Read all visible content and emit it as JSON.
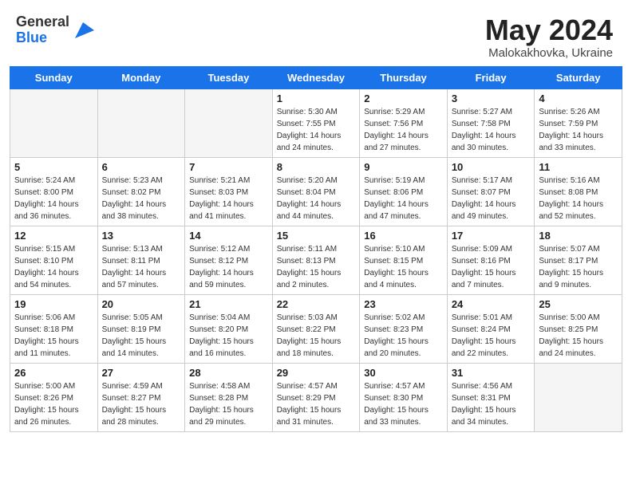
{
  "header": {
    "logo_general": "General",
    "logo_blue": "Blue",
    "month_year": "May 2024",
    "location": "Malokakhovka, Ukraine"
  },
  "weekdays": [
    "Sunday",
    "Monday",
    "Tuesday",
    "Wednesday",
    "Thursday",
    "Friday",
    "Saturday"
  ],
  "weeks": [
    [
      {
        "day": "",
        "info": ""
      },
      {
        "day": "",
        "info": ""
      },
      {
        "day": "",
        "info": ""
      },
      {
        "day": "1",
        "info": "Sunrise: 5:30 AM\nSunset: 7:55 PM\nDaylight: 14 hours\nand 24 minutes."
      },
      {
        "day": "2",
        "info": "Sunrise: 5:29 AM\nSunset: 7:56 PM\nDaylight: 14 hours\nand 27 minutes."
      },
      {
        "day": "3",
        "info": "Sunrise: 5:27 AM\nSunset: 7:58 PM\nDaylight: 14 hours\nand 30 minutes."
      },
      {
        "day": "4",
        "info": "Sunrise: 5:26 AM\nSunset: 7:59 PM\nDaylight: 14 hours\nand 33 minutes."
      }
    ],
    [
      {
        "day": "5",
        "info": "Sunrise: 5:24 AM\nSunset: 8:00 PM\nDaylight: 14 hours\nand 36 minutes."
      },
      {
        "day": "6",
        "info": "Sunrise: 5:23 AM\nSunset: 8:02 PM\nDaylight: 14 hours\nand 38 minutes."
      },
      {
        "day": "7",
        "info": "Sunrise: 5:21 AM\nSunset: 8:03 PM\nDaylight: 14 hours\nand 41 minutes."
      },
      {
        "day": "8",
        "info": "Sunrise: 5:20 AM\nSunset: 8:04 PM\nDaylight: 14 hours\nand 44 minutes."
      },
      {
        "day": "9",
        "info": "Sunrise: 5:19 AM\nSunset: 8:06 PM\nDaylight: 14 hours\nand 47 minutes."
      },
      {
        "day": "10",
        "info": "Sunrise: 5:17 AM\nSunset: 8:07 PM\nDaylight: 14 hours\nand 49 minutes."
      },
      {
        "day": "11",
        "info": "Sunrise: 5:16 AM\nSunset: 8:08 PM\nDaylight: 14 hours\nand 52 minutes."
      }
    ],
    [
      {
        "day": "12",
        "info": "Sunrise: 5:15 AM\nSunset: 8:10 PM\nDaylight: 14 hours\nand 54 minutes."
      },
      {
        "day": "13",
        "info": "Sunrise: 5:13 AM\nSunset: 8:11 PM\nDaylight: 14 hours\nand 57 minutes."
      },
      {
        "day": "14",
        "info": "Sunrise: 5:12 AM\nSunset: 8:12 PM\nDaylight: 14 hours\nand 59 minutes."
      },
      {
        "day": "15",
        "info": "Sunrise: 5:11 AM\nSunset: 8:13 PM\nDaylight: 15 hours\nand 2 minutes."
      },
      {
        "day": "16",
        "info": "Sunrise: 5:10 AM\nSunset: 8:15 PM\nDaylight: 15 hours\nand 4 minutes."
      },
      {
        "day": "17",
        "info": "Sunrise: 5:09 AM\nSunset: 8:16 PM\nDaylight: 15 hours\nand 7 minutes."
      },
      {
        "day": "18",
        "info": "Sunrise: 5:07 AM\nSunset: 8:17 PM\nDaylight: 15 hours\nand 9 minutes."
      }
    ],
    [
      {
        "day": "19",
        "info": "Sunrise: 5:06 AM\nSunset: 8:18 PM\nDaylight: 15 hours\nand 11 minutes."
      },
      {
        "day": "20",
        "info": "Sunrise: 5:05 AM\nSunset: 8:19 PM\nDaylight: 15 hours\nand 14 minutes."
      },
      {
        "day": "21",
        "info": "Sunrise: 5:04 AM\nSunset: 8:20 PM\nDaylight: 15 hours\nand 16 minutes."
      },
      {
        "day": "22",
        "info": "Sunrise: 5:03 AM\nSunset: 8:22 PM\nDaylight: 15 hours\nand 18 minutes."
      },
      {
        "day": "23",
        "info": "Sunrise: 5:02 AM\nSunset: 8:23 PM\nDaylight: 15 hours\nand 20 minutes."
      },
      {
        "day": "24",
        "info": "Sunrise: 5:01 AM\nSunset: 8:24 PM\nDaylight: 15 hours\nand 22 minutes."
      },
      {
        "day": "25",
        "info": "Sunrise: 5:00 AM\nSunset: 8:25 PM\nDaylight: 15 hours\nand 24 minutes."
      }
    ],
    [
      {
        "day": "26",
        "info": "Sunrise: 5:00 AM\nSunset: 8:26 PM\nDaylight: 15 hours\nand 26 minutes."
      },
      {
        "day": "27",
        "info": "Sunrise: 4:59 AM\nSunset: 8:27 PM\nDaylight: 15 hours\nand 28 minutes."
      },
      {
        "day": "28",
        "info": "Sunrise: 4:58 AM\nSunset: 8:28 PM\nDaylight: 15 hours\nand 29 minutes."
      },
      {
        "day": "29",
        "info": "Sunrise: 4:57 AM\nSunset: 8:29 PM\nDaylight: 15 hours\nand 31 minutes."
      },
      {
        "day": "30",
        "info": "Sunrise: 4:57 AM\nSunset: 8:30 PM\nDaylight: 15 hours\nand 33 minutes."
      },
      {
        "day": "31",
        "info": "Sunrise: 4:56 AM\nSunset: 8:31 PM\nDaylight: 15 hours\nand 34 minutes."
      },
      {
        "day": "",
        "info": ""
      }
    ]
  ]
}
